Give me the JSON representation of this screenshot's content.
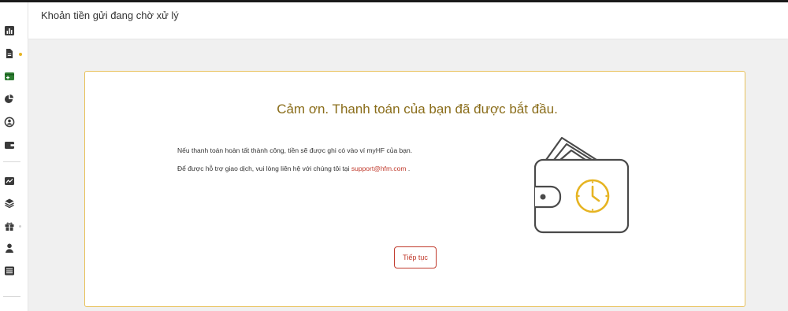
{
  "header": {
    "title": "Khoản tiền gửi đang chờ xử lý"
  },
  "sidebar": {
    "items": [
      {
        "icon": "bar-chart-icon"
      },
      {
        "icon": "document-icon"
      },
      {
        "icon": "deposit-icon",
        "active": true
      },
      {
        "icon": "pie-chart-icon"
      },
      {
        "icon": "user-circle-icon"
      },
      {
        "icon": "wallet-icon"
      },
      {
        "icon": "line-chart-icon"
      },
      {
        "icon": "layers-icon"
      },
      {
        "icon": "gift-icon"
      },
      {
        "icon": "person-icon"
      },
      {
        "icon": "list-icon"
      }
    ]
  },
  "card": {
    "title": "Cảm ơn. Thanh toán của bạn đã được bắt đầu.",
    "line1": "Nếu thanh toán hoàn tất thành công, tiền sẽ được ghi có vào ví myHF của bạn.",
    "line2_prefix": "Để được hỗ trợ giao dịch, vui lòng liên hệ với chúng tôi tại ",
    "line2_link": "support@hfm.com",
    "line2_suffix": " .",
    "button": "Tiếp tục"
  },
  "colors": {
    "accent": "#e6b422",
    "title": "#8a6d1a",
    "link": "#c0392b",
    "active_icon": "#2e7d32"
  }
}
